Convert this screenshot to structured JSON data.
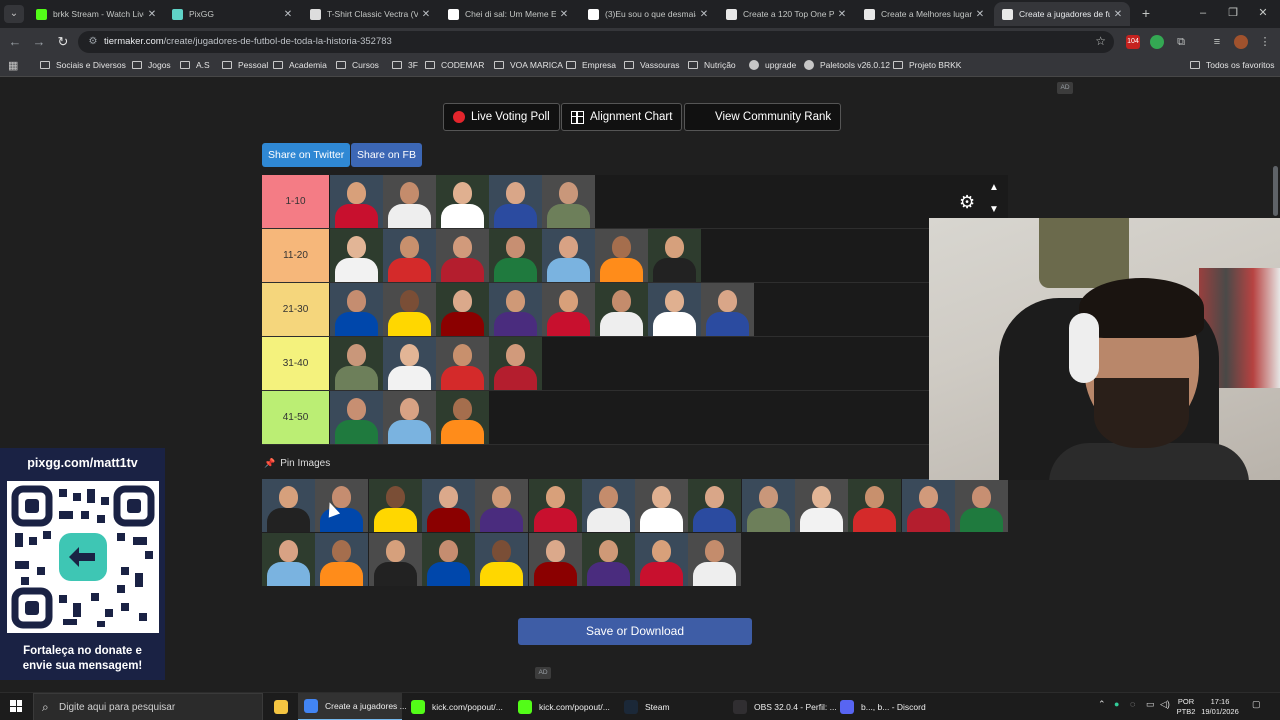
{
  "browser": {
    "tabs": [
      {
        "title": "brkk Stream - Watch Live",
        "icon": "kick-icon",
        "color": "#53fc18"
      },
      {
        "title": "PixGG",
        "icon": "pixgg-icon",
        "color": "#5fd3c7"
      },
      {
        "title": "T-Shirt Classic Vectra (Ve",
        "icon": "globe-icon",
        "color": "#dddddd"
      },
      {
        "title": "Chei di sal: Um Meme Eng",
        "icon": "tiktok-icon",
        "color": "#ffffff"
      },
      {
        "title": "(3)Eu sou o que desmaia",
        "icon": "tiktok-icon",
        "color": "#ffffff"
      },
      {
        "title": "Create a 120 Top One Pie",
        "icon": "tiermaker-icon",
        "color": "#e8e8e8"
      },
      {
        "title": "Create a Melhores lugare",
        "icon": "tiermaker-icon",
        "color": "#e8e8e8"
      },
      {
        "title": "Create a jugadores de fut",
        "icon": "tiermaker-icon",
        "color": "#e8e8e8"
      }
    ],
    "url_host": "tiermaker.com",
    "url_path": "/create/jugadores-de-futbol-de-toda-la-historia-352783",
    "bookmarks": [
      "Sociais e Diversos",
      "Jogos",
      "A.S",
      "Pessoal",
      "Academia",
      "Cursos",
      "3F",
      "CODEMAR",
      "VOA MARICA",
      "Empresa",
      "Vassouras",
      "Nutrição",
      "upgrade",
      "Paletools v26.0.12",
      "Projeto BRKK"
    ],
    "all_bookmarks": "Todos os favoritos",
    "extension_badge": "104"
  },
  "page": {
    "ad_label": "AD",
    "buttons": {
      "live_voting": "Live Voting Poll",
      "alignment_chart": "Alignment Chart",
      "community_rank": "View Community Rank",
      "share_twitter": "Share on Twitter",
      "share_fb": "Share on FB",
      "save": "Save or Download"
    },
    "tiers": [
      {
        "label": "1-10",
        "color": "#f47c85",
        "count": 5
      },
      {
        "label": "11-20",
        "color": "#f6b77a",
        "count": 7
      },
      {
        "label": "21-30",
        "color": "#f5d67c",
        "count": 8
      },
      {
        "label": "31-40",
        "color": "#f4f27d",
        "count": 4
      },
      {
        "label": "41-50",
        "color": "#bbee74",
        "count": 3
      }
    ],
    "pin_images_label": "Pin Images",
    "pool_count_row1": 14,
    "pool_count_row2": 9
  },
  "overlay": {
    "url": "pixgg.com/matt1tv",
    "message_line1": "Fortaleça no donate e",
    "message_line2": "envie sua mensagem!"
  },
  "taskbar": {
    "search_placeholder": "Digite aqui para pesquisar",
    "apps": [
      {
        "label": "Create a jugadores ...",
        "color": "#4285f4"
      },
      {
        "label": "kick.com/popout/...",
        "color": "#53fc18"
      },
      {
        "label": "kick.com/popout/...",
        "color": "#53fc18"
      },
      {
        "label": "Steam",
        "color": "#1b2838"
      },
      {
        "label": "OBS 32.0.4 - Perfil: ...",
        "color": "#302e31"
      },
      {
        "label": "b..., b... - Discord",
        "color": "#5865f2"
      }
    ],
    "lang_top": "POR",
    "lang_bottom": "PTB2",
    "time": "17:16",
    "date": "19/01/2026"
  }
}
